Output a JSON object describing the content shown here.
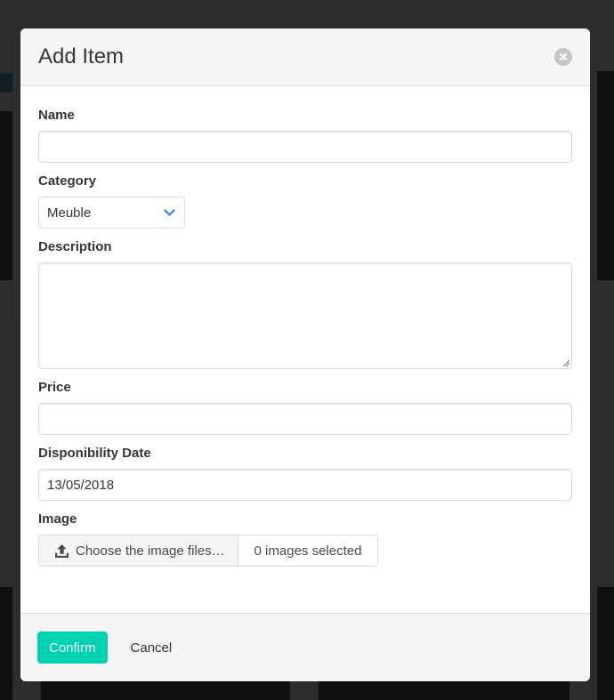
{
  "modal": {
    "title": "Add Item",
    "close_icon": "close-icon"
  },
  "form": {
    "name": {
      "label": "Name",
      "value": ""
    },
    "category": {
      "label": "Category",
      "selected": "Meuble"
    },
    "description": {
      "label": "Description",
      "value": ""
    },
    "price": {
      "label": "Price",
      "value": ""
    },
    "date": {
      "label": "Disponibility Date",
      "value": "13/05/2018"
    },
    "image": {
      "label": "Image",
      "button_label": "Choose the image files…",
      "selected_text": "0 images selected",
      "icon": "upload-icon"
    }
  },
  "footer": {
    "confirm_label": "Confirm",
    "cancel_label": "Cancel"
  },
  "colors": {
    "accent": "#00d1b2",
    "select_arrow": "#3273dc"
  }
}
